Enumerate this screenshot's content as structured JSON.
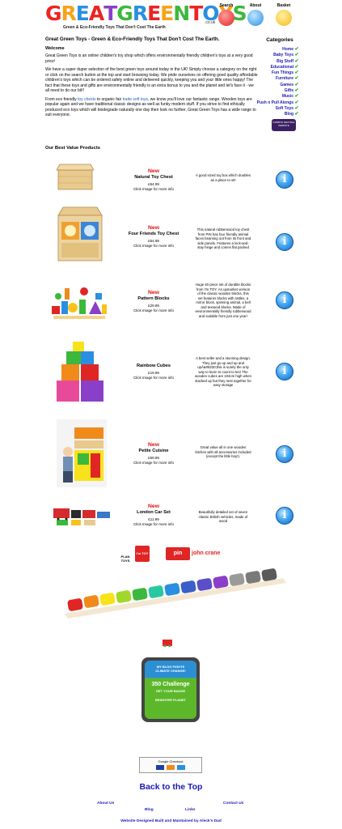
{
  "header": {
    "logo_text": "GREATGREENTOYS",
    "logo_domain": ".co.uk",
    "tagline": "Green & Eco-Friendly Toys That Don't Cost The Earth",
    "nav": [
      {
        "label": "Search",
        "icon": "search-icon"
      },
      {
        "label": "About",
        "icon": "info-icon"
      },
      {
        "label": "Basket",
        "icon": "basket-icon"
      }
    ]
  },
  "intro": {
    "title": "Great Green Toys - Green & Eco-Friendly Toys That Don't Cost The Earth.",
    "welcome": "Welcome",
    "p1": "Great Green Toys is an online children's toy shop which offers environmentally friendly children's toys at a very good price!",
    "p2": "We have a super duper selection of the best green toys around today in the UK! Simply choose a category on the right or click on the search button at the top and start browsing today. We pride ourselves on offering good quality affordable children's toys which can be ordered safely online and delivered quickly, keeping you and your little ones happy! The fact that these toys and gifts are environmentally friendly is an extra bonus to you and the planet and let's face it - we all need to do our bit!!",
    "p3_a": "From eco friendly ",
    "p3_link1": "toy chests",
    "p3_b": " to organic fair ",
    "p3_link2": "trade soft toys",
    "p3_c": ", we know you'll love our fantastic range. Wooden toys are popular again and we have traditional classic designs as well as funky modern stuff. If you strive to find ethically produced eco toys which will biodegrade naturally one day then look no further, Great Green Toys has a wide range to suit everyone."
  },
  "categories": {
    "title": "Categories",
    "items": [
      "Home",
      "Baby Toys",
      "Big Stuff",
      "Educational",
      "Fun Things",
      "Furniture",
      "Games",
      "Gifts",
      "Music",
      "Push n Pull Alongs",
      "Soft Toys",
      "Blog"
    ],
    "badge": "CARBON NEUTRAL WEBSITE"
  },
  "products_title": "Our Best Value Products",
  "products": [
    {
      "new": "New",
      "name": "Natural Toy Chest",
      "price": "£54.99",
      "cta": "Click Image for more info",
      "desc": "A good sized toy box which doubles as a place to sit!"
    },
    {
      "new": "New",
      "name": "Four Friends Toy Chest",
      "price": "£54.99",
      "cta": "Click Image for more info",
      "desc": "This natural rubberwood toy chest from PIN has four friendly animal faces beaming out from its front and side panels. Features a lock-and-stay hinge and comes flat packed"
    },
    {
      "new": "New",
      "name": "Pattern Blocks",
      "price": "£29.99",
      "cta": "Click Image for more info",
      "desc": "Huge 40 piece set of durable blocks from I'm TOY. An upmarket version of the classic wooden blocks, this set features blocks with rattles, a mirror block, spinning animal, a bell and textured blocks. Made of environmentally friendly rubberwood and suitable from just one year!"
    },
    {
      "new": "",
      "name": "Rainbow Cubes",
      "price": "£19.99",
      "cta": "Click Image for more info",
      "desc": "A best seller and a stunning design. They just go up and up and upÂ&#8230;this is surely the only way to learn to count to ten! The wooden cubes are 104cm high when stacked up but they nest together for easy storage"
    },
    {
      "new": "New",
      "name": "Petite Cuisine",
      "price": "£59.99",
      "cta": "Click Image for more info",
      "desc": "Great value all in one wooden kitchen with all accessories included (except the little boy!)."
    },
    {
      "new": "New",
      "name": "London Car Set",
      "price": "£11.99",
      "cta": "Click Image for more info",
      "desc": "Beautifully detailed set of seven classic British vehicles, made of wood"
    }
  ],
  "brands": [
    "PLAN TOYS",
    "I'm TOY",
    "pin",
    "john crane"
  ],
  "badge350": {
    "line1": "MY BLOG FIGHTS",
    "line2": "CLIMATE CHANGE!",
    "line3": "350 Challenge",
    "line4": "GET YOUR BADGE",
    "line5": "BRIGHTER PLANET"
  },
  "checkout": "Google Checkout",
  "back_to_top": "Back to the Top",
  "footer": {
    "about": "About Us",
    "contact": "Contact Us",
    "blog": "Blog",
    "links": "Links",
    "credit": "Website Designed Built and Maintained by Aleck's Dad"
  },
  "colors": {
    "link": "#1a1ab4",
    "new": "#e01010",
    "tick": "#2aa020"
  }
}
